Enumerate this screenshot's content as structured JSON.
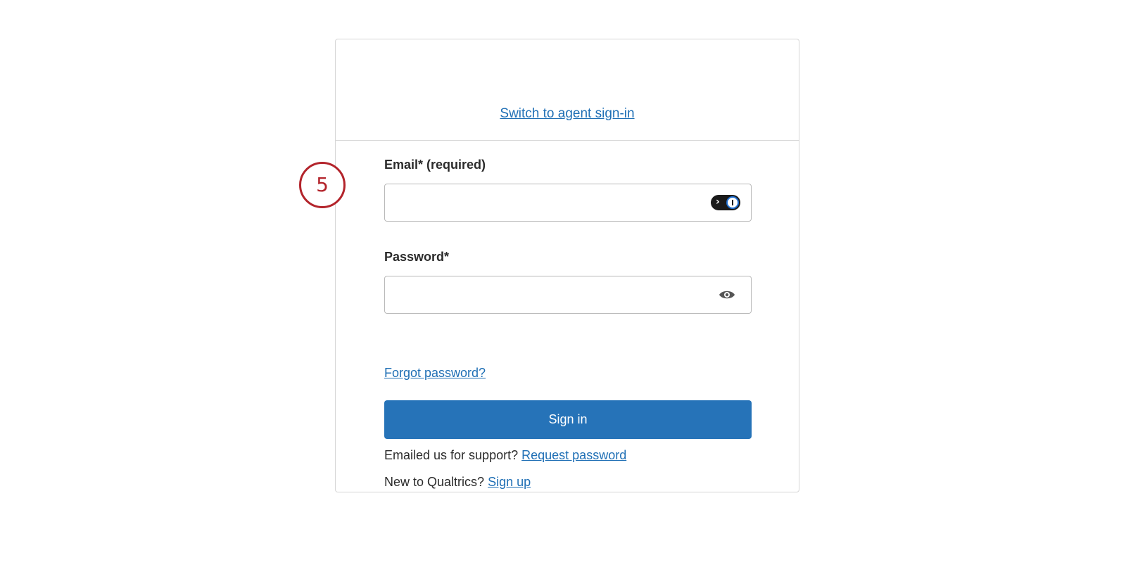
{
  "header": {
    "agent_link": "Switch to agent sign-in"
  },
  "form": {
    "email_label": "Email* (required)",
    "email_value": "",
    "password_label": "Password*",
    "password_value": "",
    "forgot_link": "Forgot password?",
    "signin_button": "Sign in",
    "support_text": "Emailed us for support?",
    "support_link": "Request password",
    "new_text": "New to Qualtrics?",
    "signup_link": "Sign up"
  },
  "icons": {
    "email_field_icon": "password-manager-icon",
    "password_field_icon": "eye-icon"
  },
  "annotation": {
    "step_number": "5"
  },
  "colors": {
    "link": "#1f6fb5",
    "primary_button": "#2673b8",
    "annotation": "#b3242b"
  }
}
